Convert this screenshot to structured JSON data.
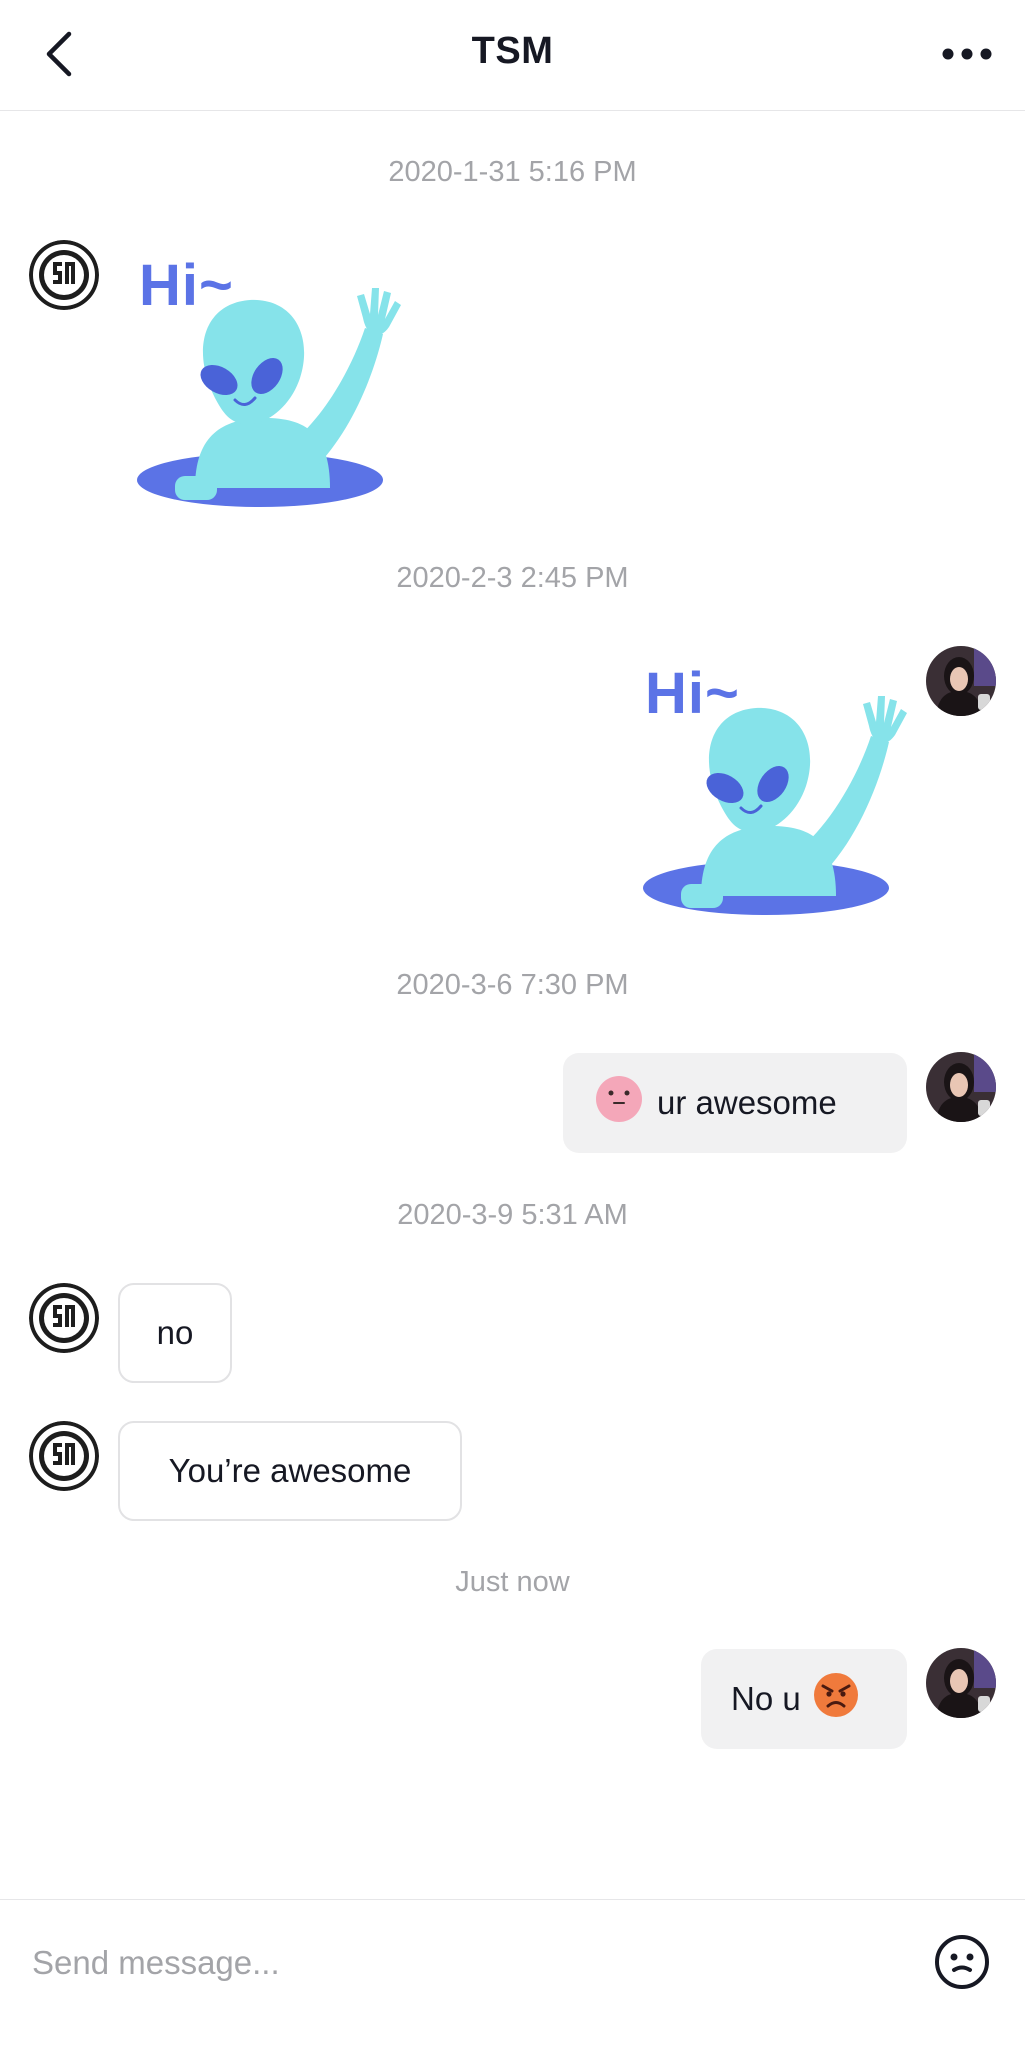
{
  "header": {
    "title": "TSM",
    "back_icon": "chevron-left-icon",
    "more_icon": "more-horizontal-icon"
  },
  "messages": [
    {
      "timestamp": "2020-1-31 5:16 PM",
      "sender": "TSM",
      "type": "sticker",
      "sticker_text": "Hi~"
    },
    {
      "timestamp": "2020-2-3 2:45 PM",
      "sender": "me",
      "type": "sticker",
      "sticker_text": "Hi~"
    },
    {
      "timestamp": "2020-3-6 7:30 PM",
      "sender": "me",
      "type": "text",
      "text": "ur awesome",
      "emoji": "blush-face-icon"
    },
    {
      "timestamp": "2020-3-9 5:31 AM",
      "sender": "TSM",
      "type": "text",
      "text": "no"
    },
    {
      "sender": "TSM",
      "type": "text",
      "text": "You’re awesome"
    },
    {
      "timestamp": "Just now",
      "sender": "me",
      "type": "text",
      "text": "No u",
      "emoji": "angry-face-icon"
    }
  ],
  "input": {
    "placeholder": "Send message...",
    "emoji_button_icon": "smiley-face-icon"
  },
  "colors": {
    "accent_sticker_text": "#5b73e6",
    "alien_body": "#86e3ea",
    "outgoing_bubble": "#f1f1f2",
    "timestamp_text": "#a3a4a8",
    "divider": "#e6e6e8"
  }
}
